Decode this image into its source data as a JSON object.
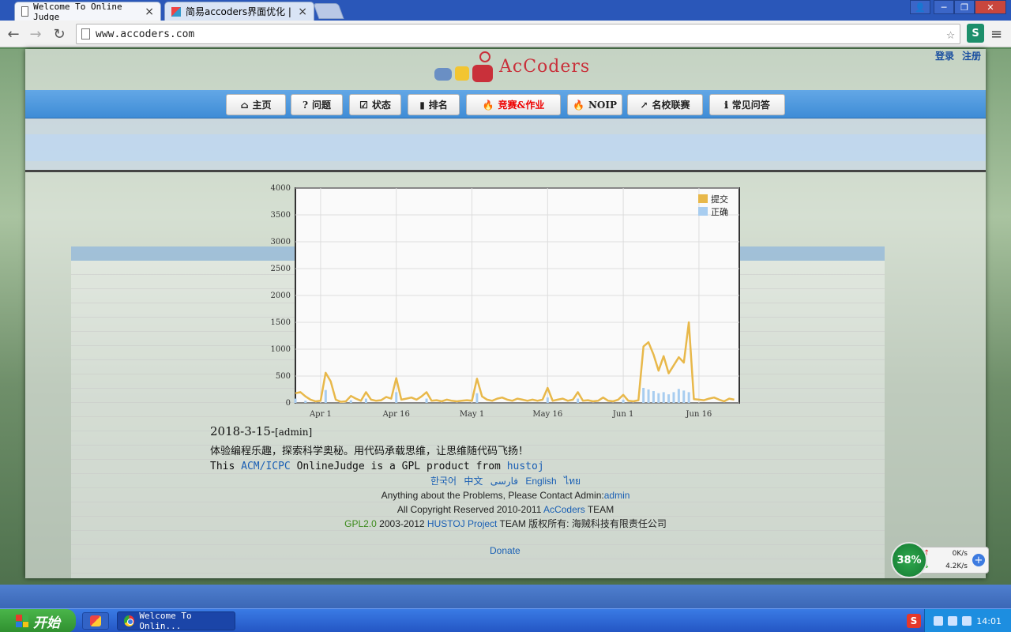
{
  "browser": {
    "tabs": [
      {
        "title": "Welcome To Online Judge",
        "active": true
      },
      {
        "title": "简易accoders界面优化 |",
        "active": false
      }
    ],
    "url": "www.accoders.com",
    "ext_badge": "S",
    "win_controls": [
      "─",
      "❐",
      "✕"
    ]
  },
  "site": {
    "logo_text": "AcCoders",
    "login": "登录",
    "register": "注册",
    "nav": [
      {
        "icon": "home-icon",
        "glyph": "⌂",
        "label": "主页"
      },
      {
        "icon": "question-icon",
        "glyph": "?",
        "label": "问题"
      },
      {
        "icon": "check-icon",
        "glyph": "☑",
        "label": "状态"
      },
      {
        "icon": "bars-icon",
        "glyph": "▮",
        "label": "排名"
      },
      {
        "icon": "flame-icon",
        "glyph": "🔥",
        "label": "竞赛&作业"
      },
      {
        "icon": "flame-icon",
        "glyph": "🔥",
        "label": "NOIP"
      },
      {
        "icon": "external-icon",
        "glyph": "↗",
        "label": "名校联赛"
      },
      {
        "icon": "info-icon",
        "glyph": "ℹ",
        "label": "常见问答"
      }
    ]
  },
  "news": {
    "date": "2018-3-15-",
    "author": "[admin]",
    "slogan": "体验编程乐趣，探索科学奥秘。用代码承载思维，让思维随代码飞扬！",
    "gpl_prefix": "This ",
    "gpl_link": "ACM/ICPC",
    "gpl_middle": " OnlineJudge is a GPL product from ",
    "gpl_link2": "hustoj"
  },
  "footer": {
    "langs": [
      "한국어",
      "中文",
      "فارسی",
      "English",
      "ไทย"
    ],
    "contact_prefix": "Anything about the Problems, Please Contact Admin:",
    "contact_link": "admin",
    "copyright_prefix": "All Copyright Reserved 2010-2011 ",
    "copyright_link": "AcCoders",
    "copyright_suffix": " TEAM",
    "gpl": "GPL2.0",
    "gpl_mid": " 2003-2012 ",
    "hustoj_link": "HUSTOJ Project",
    "gpl_suffix": " TEAM 版权所有: 海贼科技有限责任公司",
    "donate": "Donate"
  },
  "speed_widget": {
    "percent": "38%",
    "up": "0K/s",
    "down": "4.2K/s"
  },
  "taskbar": {
    "start": "开始",
    "task": "Welcome To Onlin...",
    "clock": "14:01"
  },
  "chart_data": {
    "type": "line",
    "legend": [
      "提交",
      "正确"
    ],
    "legend_position": "top-right",
    "ylim": [
      0,
      4000
    ],
    "yticks": [
      0,
      500,
      1000,
      1500,
      2000,
      2500,
      3000,
      3500,
      4000
    ],
    "xticks": [
      "Apr 1",
      "Apr 16",
      "May 1",
      "May 16",
      "Jun 1",
      "Jun 16"
    ],
    "x_range_days": [
      -5,
      83
    ],
    "colors": {
      "submit": "#e8b84a",
      "correct": "#a8cdf0"
    },
    "series": [
      {
        "name": "提交",
        "values": [
          [
            -5,
            180
          ],
          [
            -4,
            200
          ],
          [
            -3,
            120
          ],
          [
            -2,
            60
          ],
          [
            -1,
            30
          ],
          [
            0,
            40
          ],
          [
            1,
            560
          ],
          [
            2,
            400
          ],
          [
            3,
            60
          ],
          [
            4,
            20
          ],
          [
            5,
            30
          ],
          [
            6,
            130
          ],
          [
            7,
            80
          ],
          [
            8,
            40
          ],
          [
            9,
            200
          ],
          [
            10,
            60
          ],
          [
            11,
            40
          ],
          [
            12,
            50
          ],
          [
            13,
            110
          ],
          [
            14,
            80
          ],
          [
            15,
            460
          ],
          [
            16,
            60
          ],
          [
            17,
            80
          ],
          [
            18,
            100
          ],
          [
            19,
            60
          ],
          [
            20,
            120
          ],
          [
            21,
            200
          ],
          [
            22,
            40
          ],
          [
            23,
            50
          ],
          [
            24,
            30
          ],
          [
            25,
            60
          ],
          [
            26,
            40
          ],
          [
            27,
            30
          ],
          [
            28,
            40
          ],
          [
            29,
            50
          ],
          [
            30,
            40
          ],
          [
            31,
            450
          ],
          [
            32,
            120
          ],
          [
            33,
            60
          ],
          [
            34,
            40
          ],
          [
            35,
            80
          ],
          [
            36,
            100
          ],
          [
            37,
            60
          ],
          [
            38,
            40
          ],
          [
            39,
            80
          ],
          [
            40,
            60
          ],
          [
            41,
            40
          ],
          [
            42,
            60
          ],
          [
            43,
            40
          ],
          [
            44,
            60
          ],
          [
            45,
            280
          ],
          [
            46,
            40
          ],
          [
            47,
            60
          ],
          [
            48,
            80
          ],
          [
            49,
            40
          ],
          [
            50,
            60
          ],
          [
            51,
            200
          ],
          [
            52,
            40
          ],
          [
            53,
            50
          ],
          [
            54,
            30
          ],
          [
            55,
            40
          ],
          [
            56,
            100
          ],
          [
            57,
            40
          ],
          [
            58,
            30
          ],
          [
            59,
            60
          ],
          [
            60,
            150
          ],
          [
            61,
            40
          ],
          [
            62,
            30
          ],
          [
            63,
            50
          ],
          [
            64,
            1050
          ],
          [
            65,
            1130
          ],
          [
            66,
            900
          ],
          [
            67,
            600
          ],
          [
            68,
            870
          ],
          [
            69,
            550
          ],
          [
            70,
            700
          ],
          [
            71,
            850
          ],
          [
            72,
            750
          ],
          [
            73,
            1500
          ],
          [
            74,
            70
          ],
          [
            75,
            60
          ],
          [
            76,
            50
          ],
          [
            77,
            80
          ],
          [
            78,
            100
          ],
          [
            79,
            60
          ],
          [
            80,
            30
          ],
          [
            81,
            80
          ],
          [
            82,
            60
          ]
        ]
      },
      {
        "name": "正确",
        "values": [
          [
            -5,
            80
          ],
          [
            -3,
            40
          ],
          [
            1,
            240
          ],
          [
            6,
            50
          ],
          [
            9,
            80
          ],
          [
            15,
            200
          ],
          [
            21,
            80
          ],
          [
            31,
            180
          ],
          [
            45,
            100
          ],
          [
            51,
            80
          ],
          [
            60,
            60
          ],
          [
            64,
            280
          ],
          [
            65,
            250
          ],
          [
            66,
            220
          ],
          [
            67,
            180
          ],
          [
            68,
            200
          ],
          [
            69,
            160
          ],
          [
            70,
            200
          ],
          [
            71,
            260
          ],
          [
            72,
            230
          ],
          [
            73,
            200
          ]
        ]
      }
    ]
  }
}
